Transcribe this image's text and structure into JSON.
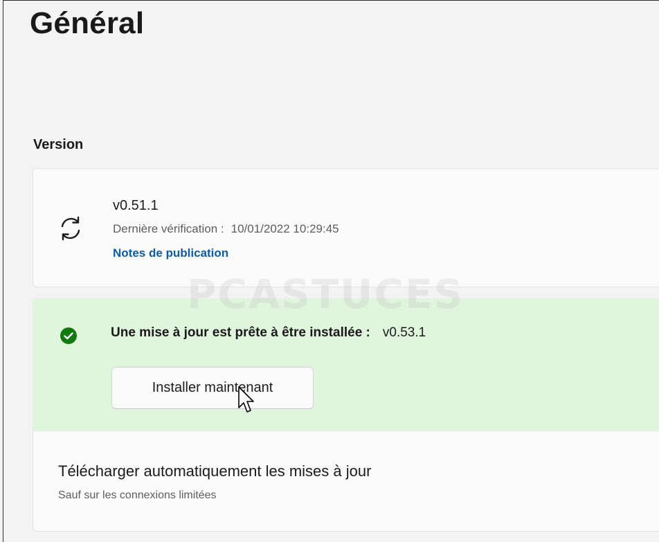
{
  "page": {
    "title": "Général"
  },
  "version_section": {
    "label": "Version",
    "current_version": "v0.51.1",
    "last_check_label": "Dernière vérification :",
    "last_check_value": "10/01/2022 10:29:45",
    "release_notes_link": "Notes de publication",
    "icon": "sync-icon"
  },
  "update_banner": {
    "message": "Une mise à jour est prête à être installée :",
    "new_version": "v0.53.1",
    "install_button": "Installer maintenant",
    "icon": "check-circle-icon",
    "background_color": "#dff6dd",
    "icon_color": "#0f7b0f"
  },
  "auto_download": {
    "title": "Télécharger automatiquement les mises à jour",
    "subtitle": "Sauf sur les connexions limitées"
  },
  "watermark": {
    "text": "PCASTUCES"
  },
  "colors": {
    "accent_link": "#0f5ba8"
  }
}
